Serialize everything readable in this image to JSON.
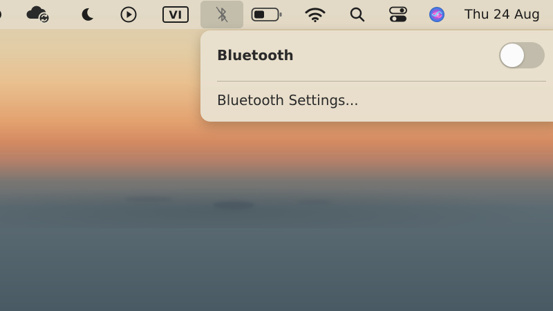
{
  "menubar": {
    "items": [
      {
        "icon": "creative-cloud-sync-icon"
      },
      {
        "icon": "moon-icon"
      },
      {
        "icon": "play-circle-icon"
      },
      {
        "icon": "input-source-icon",
        "label": "VI"
      },
      {
        "icon": "bluetooth-off-icon",
        "active": true
      },
      {
        "icon": "battery-icon",
        "level": 0.45
      },
      {
        "icon": "wifi-icon"
      },
      {
        "icon": "search-icon"
      },
      {
        "icon": "control-center-icon"
      },
      {
        "icon": "siri-icon"
      }
    ],
    "clock": "Thu 24 Aug"
  },
  "bluetooth_menu": {
    "title": "Bluetooth",
    "toggle_on": false,
    "settings_label": "Bluetooth Settings..."
  },
  "colors": {
    "menubar_bg": "#e4ddcc",
    "panel_bg": "#e8e0ce",
    "toggle_off": "#beb8a8",
    "text": "#2a2a2a"
  }
}
